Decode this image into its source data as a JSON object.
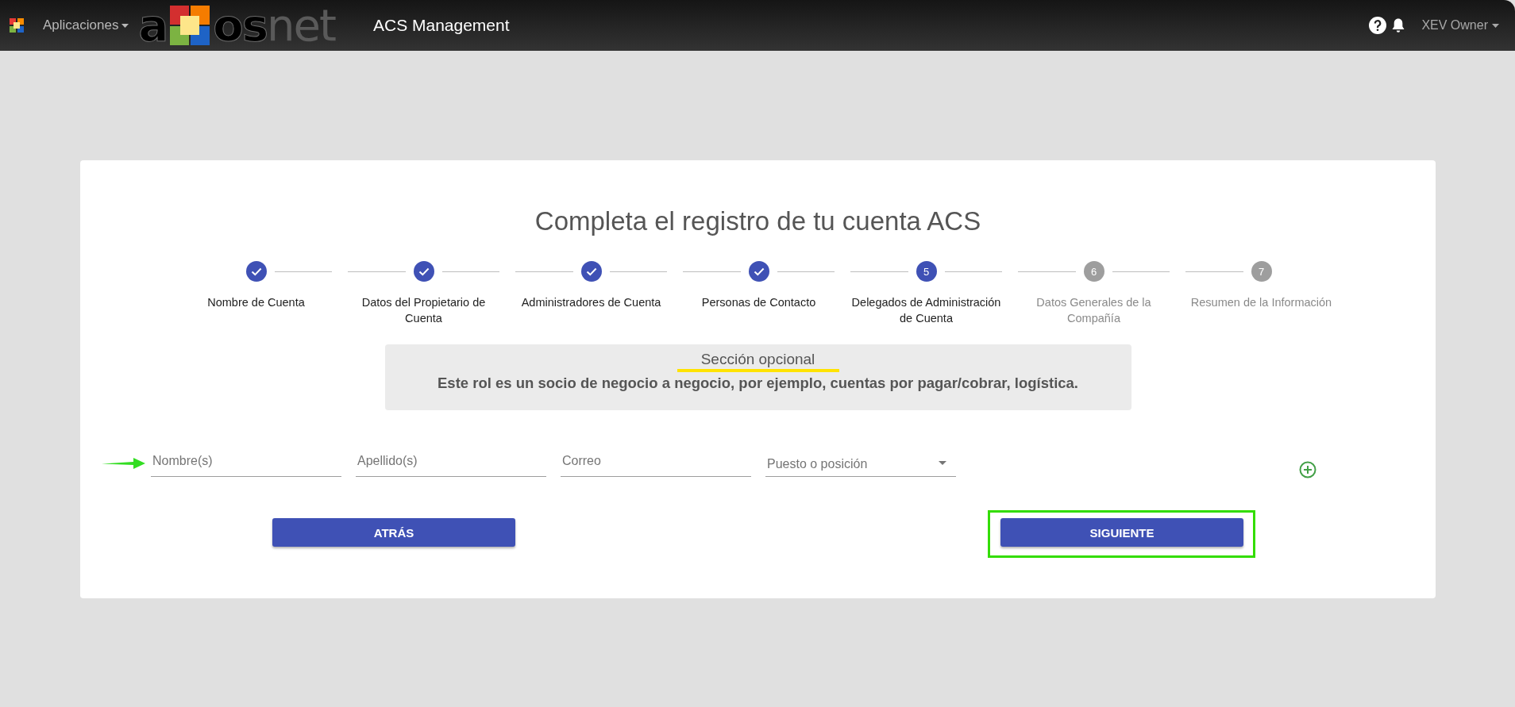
{
  "topbar": {
    "apps_menu": "Aplicaciones",
    "logo": {
      "before": "a",
      "bold": "os",
      "light": "net"
    },
    "app_title": "ACS Management",
    "user_menu": "XEV Owner"
  },
  "card": {
    "title": "Completa el registro de tu cuenta ACS",
    "steps": [
      {
        "label": "Nombre de Cuenta",
        "completed": true,
        "current": false
      },
      {
        "label": "Datos del Propietario de Cuenta",
        "completed": true,
        "current": false
      },
      {
        "label": "Administradores de Cuenta",
        "completed": true,
        "current": false
      },
      {
        "label": "Personas de Contacto",
        "completed": true,
        "current": false
      },
      {
        "number": "5",
        "label": "Delegados de Administración de Cuenta",
        "completed": false,
        "current": true
      },
      {
        "number": "6",
        "label": "Datos Generales de la Compañía",
        "completed": false,
        "current": false
      },
      {
        "number": "7",
        "label": "Resumen de la Información",
        "completed": false,
        "current": false
      }
    ],
    "note": {
      "heading": "Sección opcional",
      "heading_marked": true,
      "text": "Este rol es un socio de negocio a negocio, por ejemplo, cuentas por pagar/cobrar, logística."
    },
    "fields": [
      {
        "kind": "text",
        "placeholder": "Nombre(s)",
        "marked": true
      },
      {
        "kind": "text",
        "placeholder": "Apellido(s)",
        "marked": false
      },
      {
        "kind": "text",
        "placeholder": "Correo",
        "marked": false
      },
      {
        "kind": "select",
        "placeholder": "Puesto o posición",
        "marked": false
      }
    ],
    "buttons": [
      {
        "label": "ATRÁS",
        "marked": false
      },
      {
        "label": "SIGUIENTE",
        "marked": true
      }
    ]
  }
}
